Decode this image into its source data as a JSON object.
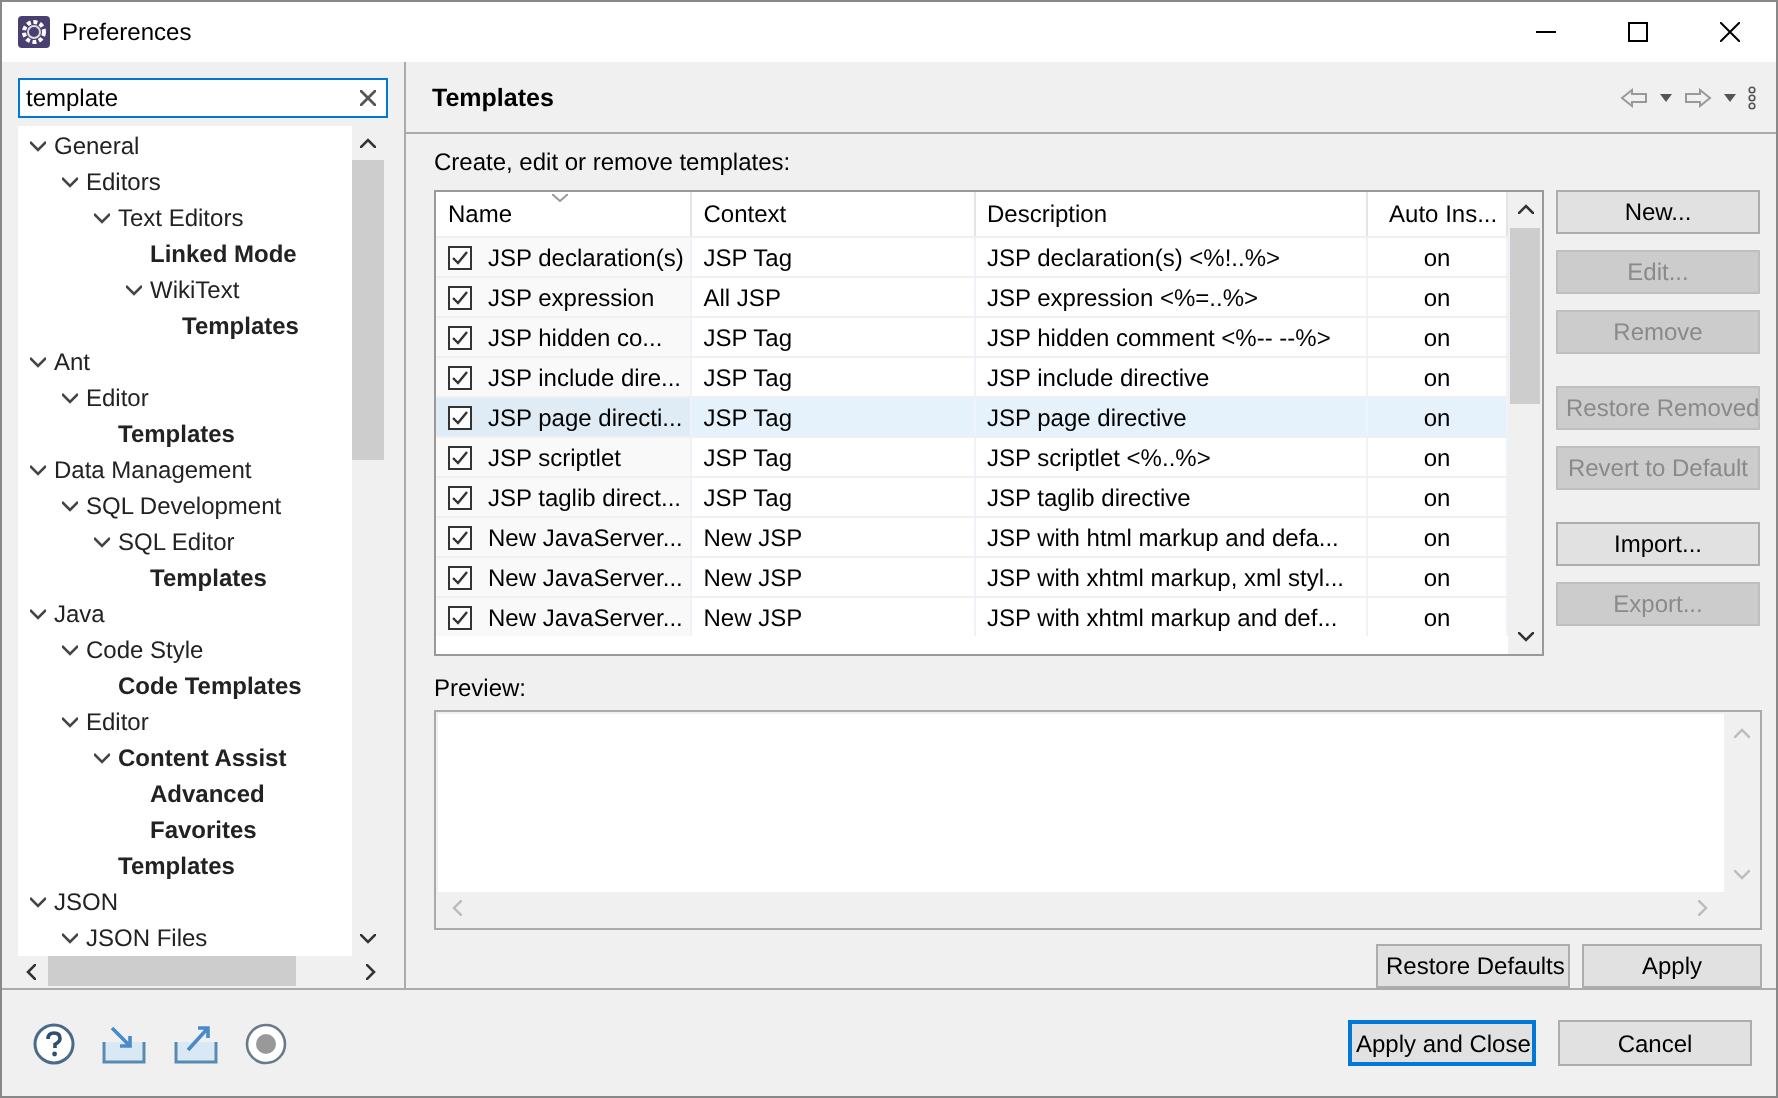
{
  "window": {
    "title": "Preferences"
  },
  "search": {
    "value": "template"
  },
  "tree": [
    {
      "label": "General",
      "expanded": true,
      "match": false,
      "children": [
        {
          "label": "Editors",
          "expanded": true,
          "match": false,
          "children": [
            {
              "label": "Text Editors",
              "expanded": true,
              "match": false,
              "children": [
                {
                  "label": "Linked Mode",
                  "match": true
                },
                {
                  "label": "WikiText",
                  "expanded": true,
                  "match": false,
                  "children": [
                    {
                      "label": "Templates",
                      "match": true
                    }
                  ]
                }
              ]
            }
          ]
        }
      ]
    },
    {
      "label": "Ant",
      "expanded": true,
      "match": false,
      "children": [
        {
          "label": "Editor",
          "expanded": true,
          "match": false,
          "children": [
            {
              "label": "Templates",
              "match": true
            }
          ]
        }
      ]
    },
    {
      "label": "Data Management",
      "expanded": true,
      "match": false,
      "children": [
        {
          "label": "SQL Development",
          "expanded": true,
          "match": false,
          "children": [
            {
              "label": "SQL Editor",
              "expanded": true,
              "match": false,
              "children": [
                {
                  "label": "Templates",
                  "match": true
                }
              ]
            }
          ]
        }
      ]
    },
    {
      "label": "Java",
      "expanded": true,
      "match": false,
      "children": [
        {
          "label": "Code Style",
          "expanded": true,
          "match": false,
          "children": [
            {
              "label": "Code Templates",
              "match": true
            }
          ]
        },
        {
          "label": "Editor",
          "expanded": true,
          "match": false,
          "children": [
            {
              "label": "Content Assist",
              "expanded": true,
              "match": true,
              "children": [
                {
                  "label": "Advanced",
                  "match": true
                },
                {
                  "label": "Favorites",
                  "match": true
                }
              ]
            },
            {
              "label": "Templates",
              "match": true
            }
          ]
        }
      ]
    },
    {
      "label": "JSON",
      "expanded": true,
      "match": false,
      "children": [
        {
          "label": "JSON Files",
          "expanded": true,
          "match": false
        }
      ]
    }
  ],
  "page": {
    "title": "Templates",
    "intro": "Create, edit or remove templates:",
    "preview_label": "Preview:"
  },
  "table": {
    "columns": [
      {
        "label": "Name",
        "sorted": true
      },
      {
        "label": "Context",
        "sorted": false
      },
      {
        "label": "Description",
        "sorted": false
      },
      {
        "label": "Auto Ins...",
        "sorted": false
      }
    ],
    "rows": [
      {
        "name": "JSP declaration(s)",
        "context": "JSP Tag",
        "description": "JSP declaration(s) <%!..%>",
        "auto_insert": "on",
        "checked": true,
        "selected": false
      },
      {
        "name": "JSP expression",
        "context": "All JSP",
        "description": "JSP expression <%=..%>",
        "auto_insert": "on",
        "checked": true,
        "selected": false
      },
      {
        "name": "JSP hidden co...",
        "context": "JSP Tag",
        "description": "JSP hidden comment <%-- --%>",
        "auto_insert": "on",
        "checked": true,
        "selected": false
      },
      {
        "name": "JSP include dire...",
        "context": "JSP Tag",
        "description": "JSP include directive",
        "auto_insert": "on",
        "checked": true,
        "selected": false
      },
      {
        "name": "JSP page directi...",
        "context": "JSP Tag",
        "description": "JSP page directive",
        "auto_insert": "on",
        "checked": true,
        "selected": true
      },
      {
        "name": "JSP scriptlet",
        "context": "JSP Tag",
        "description": "JSP scriptlet <%..%>",
        "auto_insert": "on",
        "checked": true,
        "selected": false
      },
      {
        "name": "JSP taglib direct...",
        "context": "JSP Tag",
        "description": "JSP taglib directive",
        "auto_insert": "on",
        "checked": true,
        "selected": false
      },
      {
        "name": "New JavaServer...",
        "context": "New JSP",
        "description": "JSP with html markup and defa...",
        "auto_insert": "on",
        "checked": true,
        "selected": false
      },
      {
        "name": "New JavaServer...",
        "context": "New JSP",
        "description": "JSP with xhtml markup, xml styl...",
        "auto_insert": "on",
        "checked": true,
        "selected": false
      },
      {
        "name": "New JavaServer...",
        "context": "New JSP",
        "description": "JSP with xhtml markup and def...",
        "auto_insert": "on",
        "checked": true,
        "selected": false
      }
    ]
  },
  "side_buttons": [
    [
      {
        "label": "New...",
        "disabled": false
      },
      {
        "label": "Edit...",
        "disabled": true
      },
      {
        "label": "Remove",
        "disabled": true
      }
    ],
    [
      {
        "label": "Restore Removed",
        "disabled": true
      },
      {
        "label": "Revert to Default",
        "disabled": true
      }
    ],
    [
      {
        "label": "Import...",
        "disabled": false
      },
      {
        "label": "Export...",
        "disabled": true
      }
    ]
  ],
  "page_buttons": [
    "Restore Defaults",
    "Apply"
  ],
  "dialog_buttons": [
    {
      "label": "Apply and Close",
      "default": true
    },
    {
      "label": "Cancel",
      "default": false
    }
  ]
}
